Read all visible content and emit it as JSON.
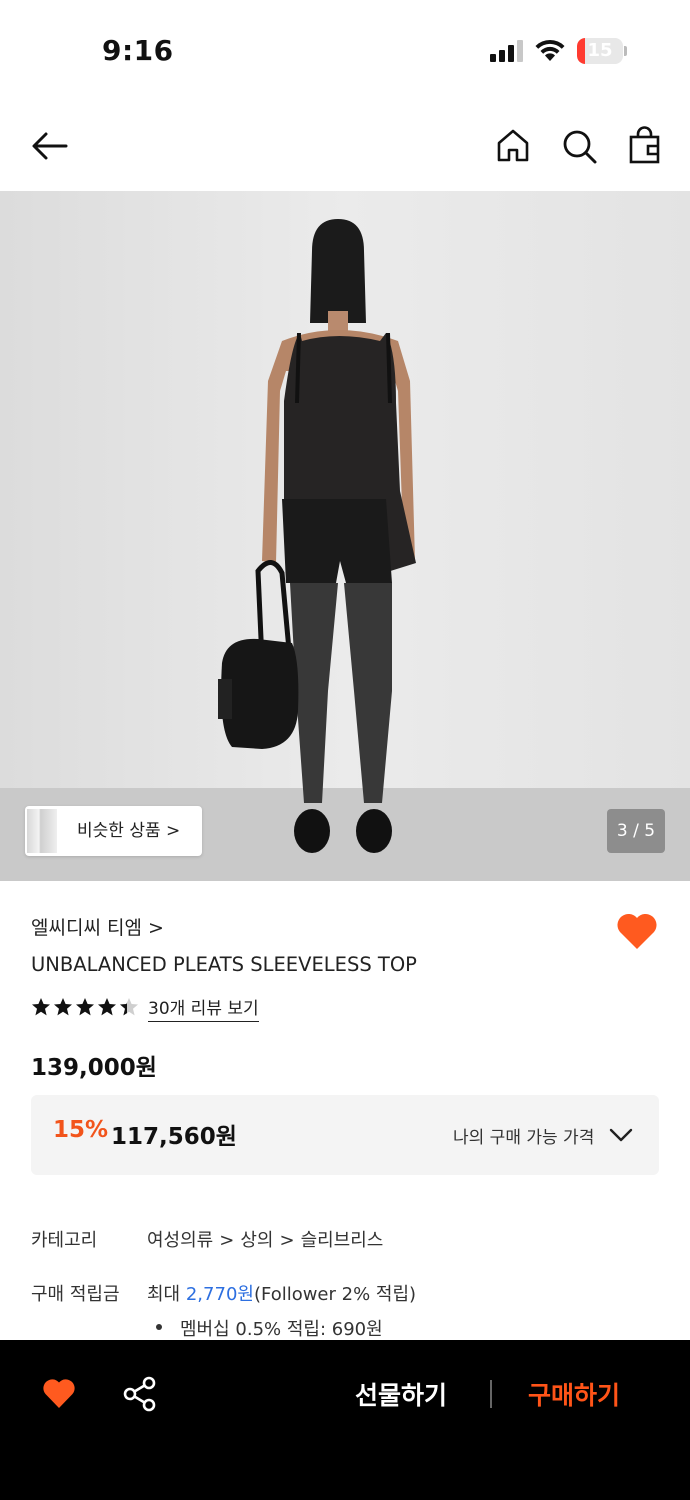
{
  "status_bar": {
    "time": "9:16",
    "battery": "15",
    "battery_level": 0.15
  },
  "nav": {
    "back": "back-arrow-icon",
    "home": "home-icon",
    "search": "search-icon",
    "bag": "shopping-bag-icon"
  },
  "gallery": {
    "similar_button": "비슷한 상품 >",
    "page_indicator": "3 / 5"
  },
  "product": {
    "brand": "엘씨디씨 티엠 >",
    "name": "UNBALANCED PLEATS SLEEVELESS TOP",
    "rating": 4.5,
    "review_link": "30개 리뷰 보기",
    "original_price": "139,000원",
    "discount_rate": "15%",
    "sale_price": "117,560원",
    "my_price_label": "나의 구매 가능 가격",
    "liked": true
  },
  "info": {
    "category_label": "카테고리",
    "category_path": [
      "여성의류",
      "상의",
      "슬리브리스"
    ],
    "points_label": "구매 적립금",
    "points_prefix": "최대",
    "points_amount": "2,770원",
    "points_suffix": "(Follower 2% 적립)",
    "membership_text": "멤버십 0.5% 적립: 690원"
  },
  "bottom_bar": {
    "gift_label": "선물하기",
    "buy_label": "구매하기"
  },
  "colors": {
    "accent": "#ff5418",
    "heart": "#ff5a1f",
    "link_blue": "#2d6fe0"
  }
}
